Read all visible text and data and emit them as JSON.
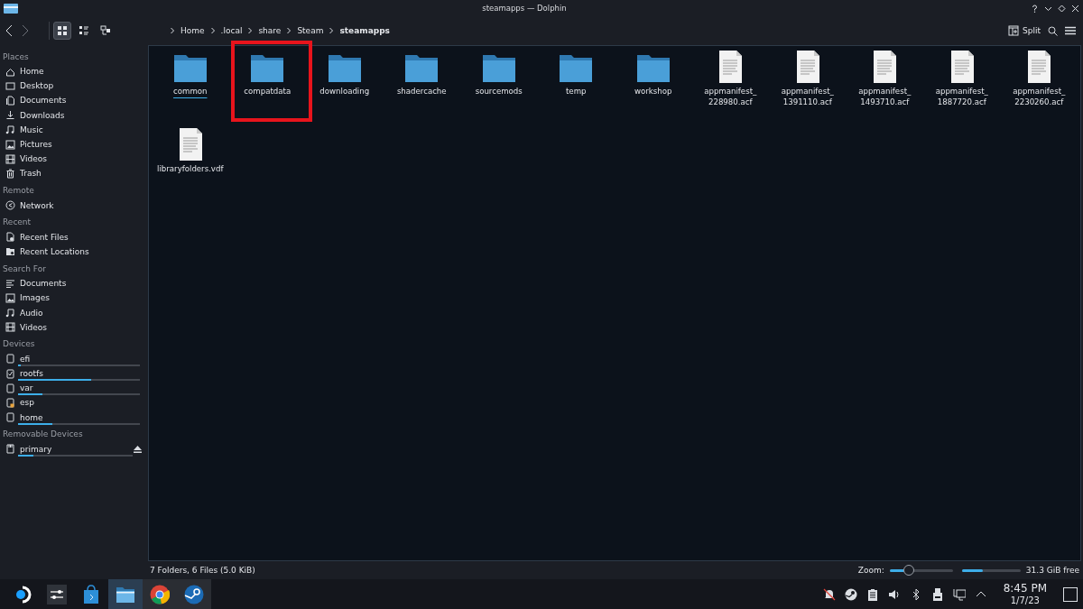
{
  "window": {
    "title": "steamapps — Dolphin"
  },
  "toolbar": {
    "view_modes": [
      {
        "selected": true
      },
      {
        "selected": false
      },
      {
        "selected": false
      }
    ],
    "breadcrumb": [
      {
        "label": "Home",
        "selected": false
      },
      {
        "label": ".local",
        "selected": false
      },
      {
        "label": "share",
        "selected": false
      },
      {
        "label": "Steam",
        "selected": false
      },
      {
        "label": "steamapps",
        "selected": true
      }
    ],
    "split_button": "Split"
  },
  "sidebar": {
    "sections": [
      {
        "title": "Places",
        "items": [
          {
            "label": "Home"
          },
          {
            "label": "Desktop"
          },
          {
            "label": "Documents"
          },
          {
            "label": "Downloads"
          },
          {
            "label": "Music"
          },
          {
            "label": "Pictures"
          },
          {
            "label": "Videos"
          },
          {
            "label": "Trash"
          }
        ]
      },
      {
        "title": "Remote",
        "items": [
          {
            "label": "Network"
          }
        ]
      },
      {
        "title": "Recent",
        "items": [
          {
            "label": "Recent Files"
          },
          {
            "label": "Recent Locations"
          }
        ]
      },
      {
        "title": "Search For",
        "items": [
          {
            "label": "Documents"
          },
          {
            "label": "Images"
          },
          {
            "label": "Audio"
          },
          {
            "label": "Videos"
          }
        ]
      },
      {
        "title": "Devices",
        "items": [
          {
            "label": "efi",
            "level": 0.02
          },
          {
            "label": "rootfs",
            "level": 0.6
          },
          {
            "label": "var",
            "level": 0.2
          },
          {
            "label": "esp"
          },
          {
            "label": "home",
            "level": 0.28
          }
        ]
      },
      {
        "title": "Removable Devices",
        "items": [
          {
            "label": "primary",
            "level": 0.13,
            "ejectable": true
          }
        ]
      }
    ]
  },
  "files": [
    {
      "kind": "folder",
      "name": "common",
      "focused": true,
      "highlighted": false
    },
    {
      "kind": "folder",
      "name": "compatdata",
      "focused": false,
      "highlighted": true
    },
    {
      "kind": "folder",
      "name": "downloading",
      "focused": false,
      "highlighted": false
    },
    {
      "kind": "folder",
      "name": "shadercache",
      "focused": false,
      "highlighted": false
    },
    {
      "kind": "folder",
      "name": "sourcemods",
      "focused": false,
      "highlighted": false
    },
    {
      "kind": "folder",
      "name": "temp",
      "focused": false,
      "highlighted": false
    },
    {
      "kind": "folder",
      "name": "workshop",
      "focused": false,
      "highlighted": false
    },
    {
      "kind": "file",
      "name": "appmanifest_228980.acf",
      "focused": false,
      "highlighted": false
    },
    {
      "kind": "file",
      "name": "appmanifest_1391110.acf",
      "focused": false,
      "highlighted": false
    },
    {
      "kind": "file",
      "name": "appmanifest_1493710.acf",
      "focused": false,
      "highlighted": false
    },
    {
      "kind": "file",
      "name": "appmanifest_1887720.acf",
      "focused": false,
      "highlighted": false
    },
    {
      "kind": "file",
      "name": "appmanifest_2230260.acf",
      "focused": false,
      "highlighted": false
    },
    {
      "kind": "file",
      "name": "libraryfolders.vdf",
      "focused": false,
      "highlighted": false
    }
  ],
  "status_bar": {
    "summary": "7 Folders, 6 Files (5.0 KiB)",
    "zoom_label": "Zoom:",
    "zoom": {
      "level": 0.3
    },
    "space": {
      "level": 0.35
    },
    "free_space": "31.3 GiB free"
  },
  "taskbar": {
    "apps": [
      {
        "selected": false
      },
      {
        "selected": false
      },
      {
        "selected": false
      },
      {
        "selected": true
      },
      {
        "selected": false
      },
      {
        "selected": false
      }
    ],
    "clock": {
      "time": "8:45 PM",
      "date": "1/7/23"
    }
  }
}
